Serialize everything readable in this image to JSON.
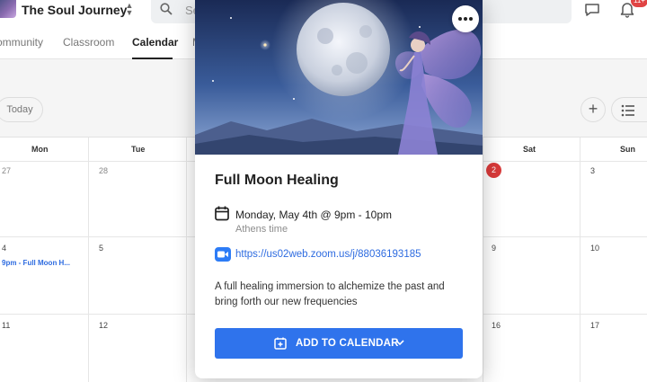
{
  "header": {
    "community_title": "The Soul Journey",
    "search_placeholder": "Se",
    "notification_count": "11+"
  },
  "tabs": [
    {
      "label": "ommunity"
    },
    {
      "label": "Classroom"
    },
    {
      "label": "Calendar",
      "active": true
    },
    {
      "label": "M"
    }
  ],
  "toolbar": {
    "today_label": "Today",
    "add_icon": "plus-icon",
    "view_icon": "list-icon"
  },
  "calendar": {
    "day_headers": [
      "Mon",
      "Tue",
      "Sat",
      "Sun"
    ],
    "week1": [
      "27",
      "28",
      "2",
      "3"
    ],
    "week2": [
      "4",
      "5",
      "9",
      "10"
    ],
    "week3": [
      "11",
      "12",
      "16",
      "17"
    ],
    "event_chip": "9pm - Full Moon H..."
  },
  "event": {
    "title": "Full Moon Healing",
    "when": "Monday, May 4th @ 9pm - 10pm",
    "timezone": "Athens time",
    "link": "https://us02web.zoom.us/j/88036193185",
    "description": "A full healing immersion to alchemize the past and bring forth our new frequencies",
    "add_button_label": "ADD TO CALENDAR",
    "accent_color": "#2f73ec"
  }
}
